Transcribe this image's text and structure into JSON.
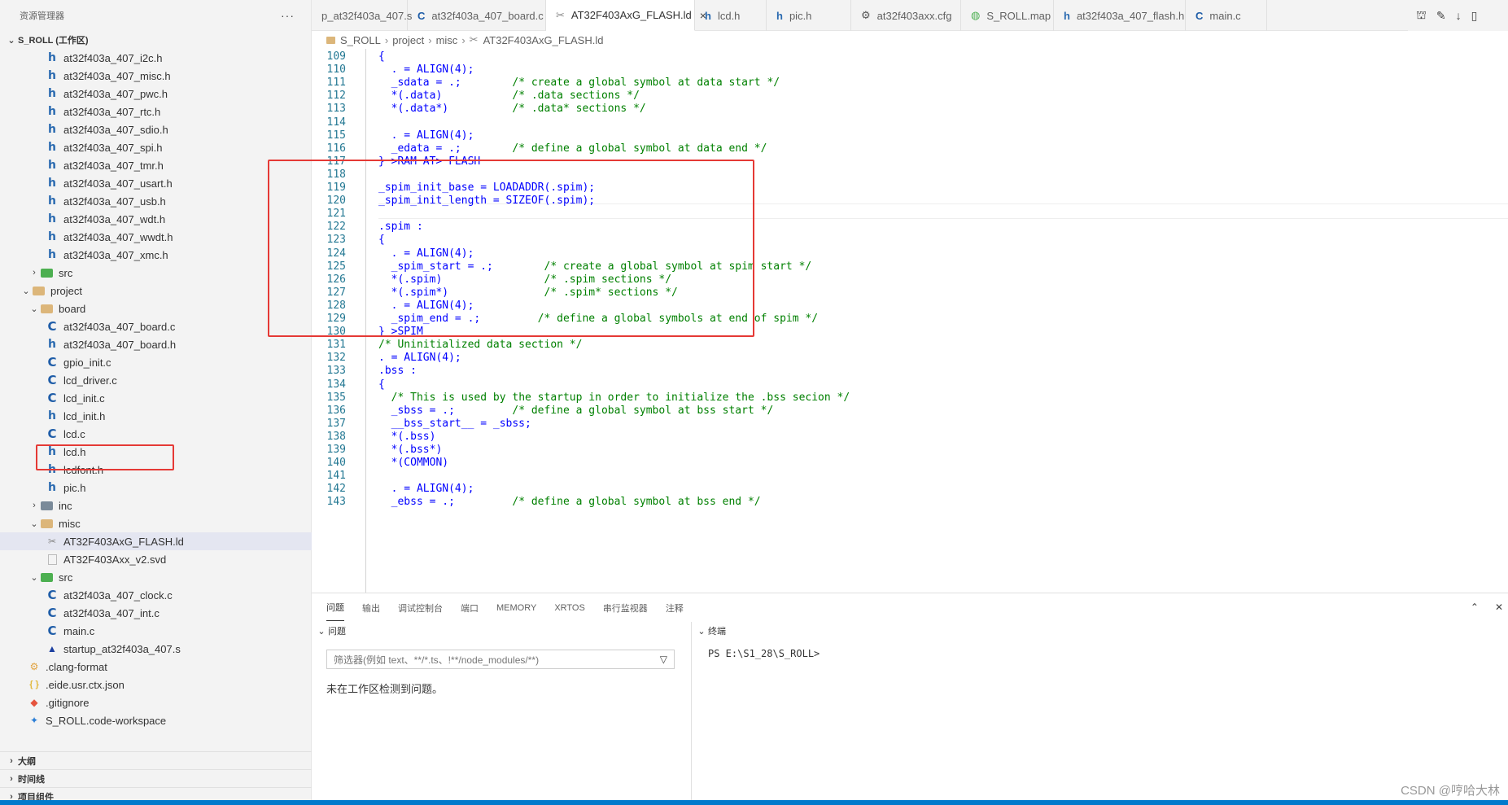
{
  "sidebar": {
    "title": "资源管理器",
    "more": "···",
    "workspace": "S_ROLL (工作区)",
    "tree": [
      {
        "label": "at32f403a_407_i2c.h",
        "icon": "h",
        "depth": 3
      },
      {
        "label": "at32f403a_407_misc.h",
        "icon": "h",
        "depth": 3
      },
      {
        "label": "at32f403a_407_pwc.h",
        "icon": "h",
        "depth": 3
      },
      {
        "label": "at32f403a_407_rtc.h",
        "icon": "h",
        "depth": 3
      },
      {
        "label": "at32f403a_407_sdio.h",
        "icon": "h",
        "depth": 3
      },
      {
        "label": "at32f403a_407_spi.h",
        "icon": "h",
        "depth": 3
      },
      {
        "label": "at32f403a_407_tmr.h",
        "icon": "h",
        "depth": 3
      },
      {
        "label": "at32f403a_407_usart.h",
        "icon": "h",
        "depth": 3
      },
      {
        "label": "at32f403a_407_usb.h",
        "icon": "h",
        "depth": 3
      },
      {
        "label": "at32f403a_407_wdt.h",
        "icon": "h",
        "depth": 3
      },
      {
        "label": "at32f403a_407_wwdt.h",
        "icon": "h",
        "depth": 3
      },
      {
        "label": "at32f403a_407_xmc.h",
        "icon": "h",
        "depth": 3
      },
      {
        "label": "src",
        "icon": "folder-green",
        "depth": 2,
        "chev": "›"
      },
      {
        "label": "project",
        "icon": "folder",
        "depth": 1,
        "chev": "⌄"
      },
      {
        "label": "board",
        "icon": "folder",
        "depth": 2,
        "chev": "⌄"
      },
      {
        "label": "at32f403a_407_board.c",
        "icon": "c",
        "depth": 3
      },
      {
        "label": "at32f403a_407_board.h",
        "icon": "h",
        "depth": 3
      },
      {
        "label": "gpio_init.c",
        "icon": "c",
        "depth": 3
      },
      {
        "label": "lcd_driver.c",
        "icon": "c",
        "depth": 3
      },
      {
        "label": "lcd_init.c",
        "icon": "c",
        "depth": 3
      },
      {
        "label": "lcd_init.h",
        "icon": "h",
        "depth": 3
      },
      {
        "label": "lcd.c",
        "icon": "c",
        "depth": 3
      },
      {
        "label": "lcd.h",
        "icon": "h",
        "depth": 3
      },
      {
        "label": "lcdfont.h",
        "icon": "h",
        "depth": 3
      },
      {
        "label": "pic.h",
        "icon": "h",
        "depth": 3
      },
      {
        "label": "inc",
        "icon": "folder-gray",
        "depth": 2,
        "chev": "›"
      },
      {
        "label": "misc",
        "icon": "folder",
        "depth": 2,
        "chev": "⌄"
      },
      {
        "label": "AT32F403AxG_FLASH.ld",
        "icon": "ld",
        "depth": 3,
        "selected": true
      },
      {
        "label": "AT32F403Axx_v2.svd",
        "icon": "file",
        "depth": 3
      },
      {
        "label": "src",
        "icon": "folder-green",
        "depth": 2,
        "chev": "⌄"
      },
      {
        "label": "at32f403a_407_clock.c",
        "icon": "c",
        "depth": 3
      },
      {
        "label": "at32f403a_407_int.c",
        "icon": "c",
        "depth": 3
      },
      {
        "label": "main.c",
        "icon": "c",
        "depth": 3
      },
      {
        "label": "startup_at32f403a_407.s",
        "icon": "asm",
        "depth": 3
      },
      {
        "label": ".clang-format",
        "icon": "clang",
        "depth": 2
      },
      {
        "label": ".eide.usr.ctx.json",
        "icon": "json",
        "depth": 2
      },
      {
        "label": ".gitignore",
        "icon": "git",
        "depth": 2
      },
      {
        "label": "S_ROLL.code-workspace",
        "icon": "vs",
        "depth": 2
      }
    ],
    "bottom_sections": [
      "大纲",
      "时间线",
      "项目组件"
    ]
  },
  "tabs": [
    {
      "label": "p_at32f403a_407.s",
      "icon": ""
    },
    {
      "label": "at32f403a_407_board.c",
      "icon": "C"
    },
    {
      "label": "AT32F403AxG_FLASH.ld",
      "icon": "ld",
      "active": true,
      "close": "×"
    },
    {
      "label": "lcd.h",
      "icon": "h"
    },
    {
      "label": "pic.h",
      "icon": "h"
    },
    {
      "label": "at32f403axx.cfg",
      "icon": "gear"
    },
    {
      "label": "S_ROLL.map",
      "icon": "globe"
    },
    {
      "label": "at32f403a_407_flash.h",
      "icon": "h"
    },
    {
      "label": "main.c",
      "icon": "C"
    }
  ],
  "breadcrumb": [
    "S_ROLL",
    "project",
    "misc",
    "AT32F403AxG_FLASH.ld"
  ],
  "editor": {
    "lines": [
      {
        "n": "109",
        "t": "{"
      },
      {
        "n": "110",
        "t": "  . = ALIGN(4);"
      },
      {
        "n": "111",
        "t": "  _sdata = .;        /* create a global symbol at data start */"
      },
      {
        "n": "112",
        "t": "  *(.data)           /* .data sections */"
      },
      {
        "n": "113",
        "t": "  *(.data*)          /* .data* sections */"
      },
      {
        "n": "114",
        "t": ""
      },
      {
        "n": "115",
        "t": "  . = ALIGN(4);"
      },
      {
        "n": "116",
        "t": "  _edata = .;        /* define a global symbol at data end */"
      },
      {
        "n": "117",
        "t": "} >RAM AT> FLASH"
      },
      {
        "n": "118",
        "t": ""
      },
      {
        "n": "119",
        "t": "_spim_init_base = LOADADDR(.spim);"
      },
      {
        "n": "120",
        "t": "_spim_init_length = SIZEOF(.spim);"
      },
      {
        "n": "121",
        "t": ""
      },
      {
        "n": "122",
        "t": ".spim :"
      },
      {
        "n": "123",
        "t": "{"
      },
      {
        "n": "124",
        "t": "  . = ALIGN(4);"
      },
      {
        "n": "125",
        "t": "  _spim_start = .;        /* create a global symbol at spim start */"
      },
      {
        "n": "126",
        "t": "  *(.spim)                /* .spim sections */"
      },
      {
        "n": "127",
        "t": "  *(.spim*)               /* .spim* sections */"
      },
      {
        "n": "128",
        "t": "  . = ALIGN(4);"
      },
      {
        "n": "129",
        "t": "  _spim_end = .;         /* define a global symbols at end of spim */"
      },
      {
        "n": "130",
        "t": "} >SPIM"
      },
      {
        "n": "131",
        "t": "/* Uninitialized data section */"
      },
      {
        "n": "132",
        "t": ". = ALIGN(4);"
      },
      {
        "n": "133",
        "t": ".bss :"
      },
      {
        "n": "134",
        "t": "{"
      },
      {
        "n": "135",
        "t": "  /* This is used by the startup in order to initialize the .bss secion */"
      },
      {
        "n": "136",
        "t": "  _sbss = .;         /* define a global symbol at bss start */"
      },
      {
        "n": "137",
        "t": "  __bss_start__ = _sbss;"
      },
      {
        "n": "138",
        "t": "  *(.bss)"
      },
      {
        "n": "139",
        "t": "  *(.bss*)"
      },
      {
        "n": "140",
        "t": "  *(COMMON)"
      },
      {
        "n": "141",
        "t": ""
      },
      {
        "n": "142",
        "t": "  . = ALIGN(4);"
      },
      {
        "n": "143",
        "t": "  _ebss = .;         /* define a global symbol at bss end */"
      }
    ]
  },
  "panel": {
    "tabs": [
      "问题",
      "输出",
      "调试控制台",
      "端口",
      "MEMORY",
      "XRTOS",
      "串行监视器",
      "注释"
    ],
    "problems_title": "问题",
    "filter_placeholder": "筛选器(例如 text、**/*.ts、!**/node_modules/**)",
    "no_problems": "未在工作区检测到问题。",
    "terminal_title": "终端",
    "terminal_prompt": "PS E:\\S1_28\\S_ROLL>"
  },
  "watermark": "CSDN @哼哈大林",
  "colors": {
    "accent": "#007acc",
    "highlight": "#e53935",
    "line_number": "#237893",
    "comment": "#008000",
    "keyword": "#0000ff"
  }
}
